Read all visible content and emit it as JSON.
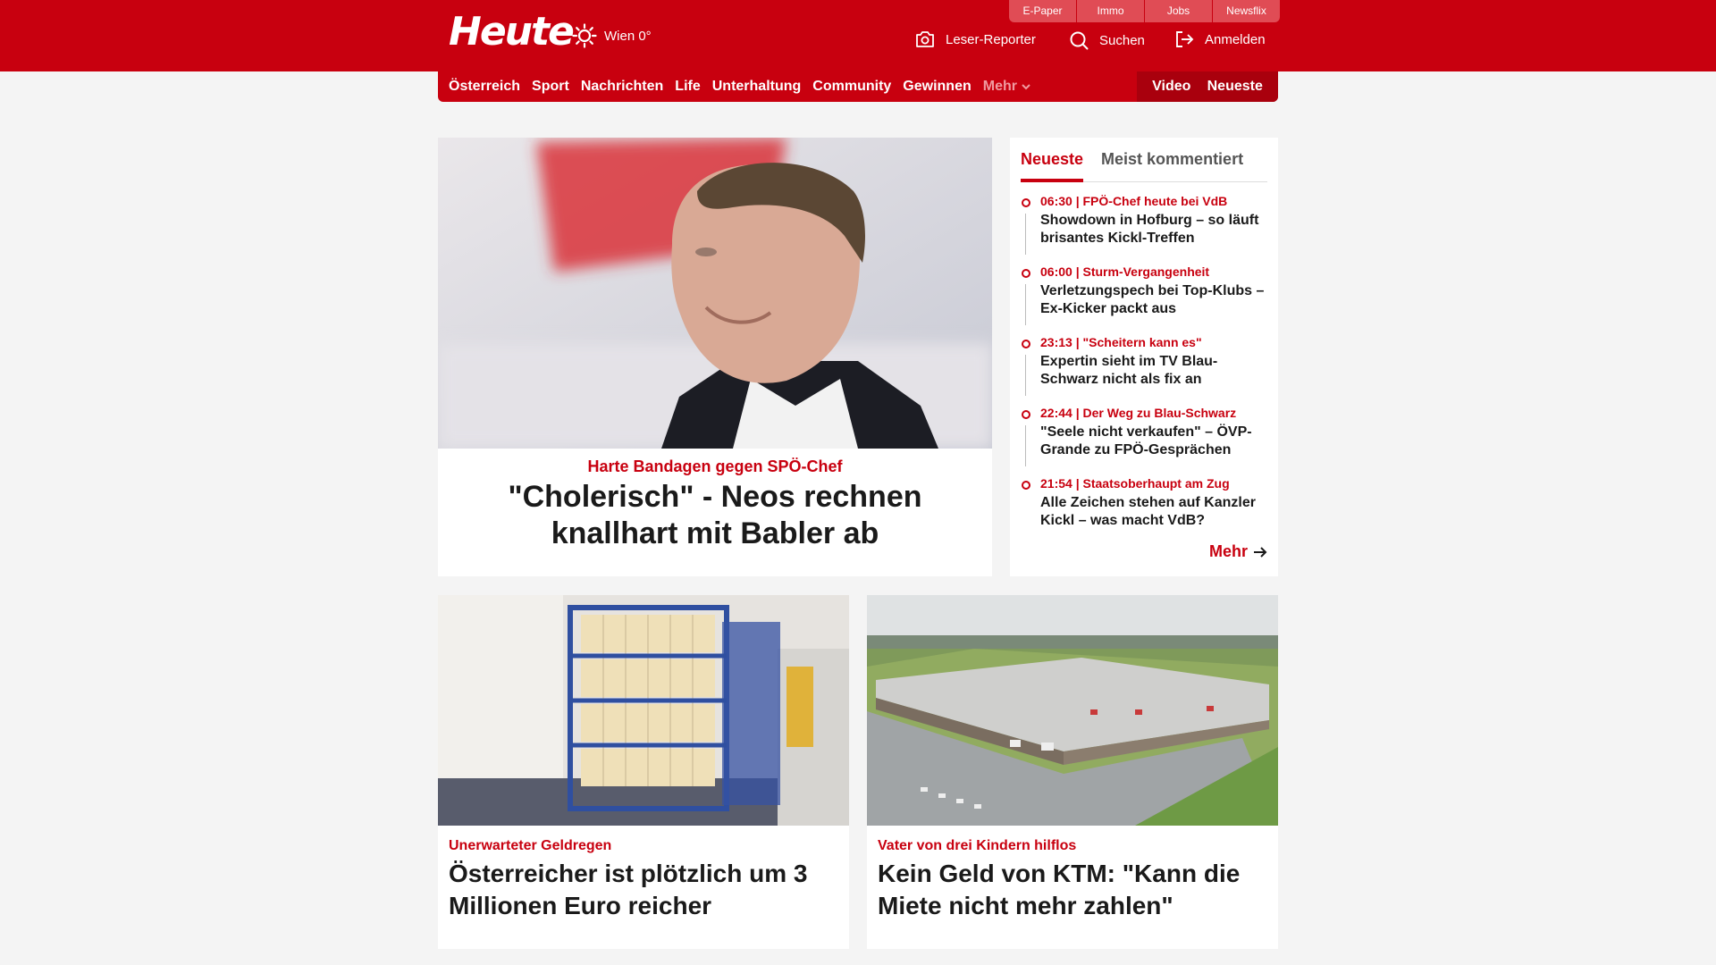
{
  "header": {
    "logo": "Heute",
    "weather": "Wien 0°",
    "top_links": [
      "E-Paper",
      "Immo",
      "Jobs",
      "Newsflix"
    ],
    "actions": {
      "reporter": "Leser-Reporter",
      "search": "Suchen",
      "login": "Anmelden"
    },
    "brand_color": "#c8000f"
  },
  "nav": {
    "items": [
      "Österreich",
      "Sport",
      "Nachrichten",
      "Life",
      "Unterhaltung",
      "Community",
      "Gewinnen"
    ],
    "more": "Mehr",
    "right": [
      "Video",
      "Neueste"
    ]
  },
  "lead": {
    "kicker": "Harte Bandagen gegen SPÖ-Chef",
    "title": "\"Cholerisch\" - Neos rechnen knallhart mit Babler ab"
  },
  "sidebar": {
    "tabs": [
      "Neueste",
      "Meist kommentiert"
    ],
    "items": [
      {
        "kicker": "06:30 | FPÖ-Chef heute bei VdB",
        "title": "Showdown in Hofburg – so läuft brisantes Kickl-Treffen"
      },
      {
        "kicker": "06:00 | Sturm-Vergangenheit",
        "title": "Verletzungspech bei Top-Klubs – Ex-Kicker packt aus"
      },
      {
        "kicker": "23:13 | \"Scheitern kann es\"",
        "title": "Expertin sieht im TV Blau-Schwarz nicht als fix an"
      },
      {
        "kicker": "22:44 | Der Weg zu Blau-Schwarz",
        "title": "\"Seele nicht verkaufen\" – ÖVP-Grande zu FPÖ-Gesprächen"
      },
      {
        "kicker": "21:54 | Staatsoberhaupt am Zug",
        "title": "Alle Zeichen stehen auf Kanzler Kickl – was macht VdB?"
      }
    ],
    "more": "Mehr"
  },
  "cards": [
    {
      "kicker": "Unerwarteter Geldregen",
      "title": "Österreicher ist plötzlich um 3 Millionen Euro reicher"
    },
    {
      "kicker": "Vater von drei Kindern hilflos",
      "title": "Kein Geld von KTM: \"Kann die Miete nicht mehr zahlen\""
    }
  ]
}
